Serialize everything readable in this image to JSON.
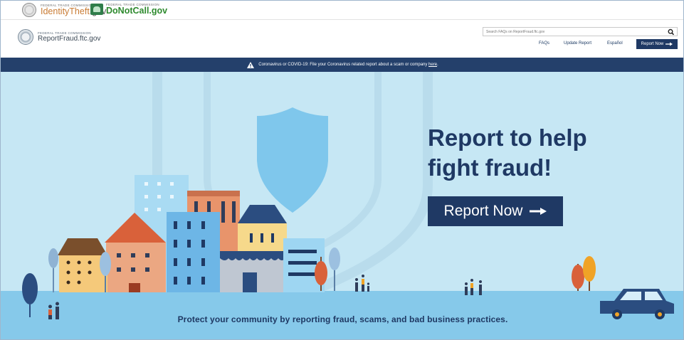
{
  "util_bar": {
    "identitytheft": {
      "agency": "FEDERAL TRADE COMMISSION",
      "name_main": "IdentityTheft",
      "name_tld": ".gov"
    },
    "donotcall": {
      "agency": "FEDERAL TRADE COMMISSION",
      "name": "DoNotCall.gov"
    }
  },
  "header": {
    "agency": "FEDERAL TRADE COMMISSION",
    "site_name": "ReportFraud.ftc.gov",
    "search": {
      "placeholder": "Search FAQs on ReportFraud.ftc.gov"
    },
    "nav": {
      "faqs": "FAQs",
      "update_report": "Update Report",
      "espanol": "Español"
    },
    "report_button": "Report Now"
  },
  "banner": {
    "text": "Coronavirus or COVID-19: File your Coronavirus related report about a scam or company",
    "link": "here",
    "end": "."
  },
  "hero": {
    "title_line1": "Report to help",
    "title_line2": "fight fraud!",
    "button": "Report Now",
    "subtitle": "Protect your community by reporting fraud, scams, and bad business practices."
  },
  "icons": {
    "seal": "ftc-seal-icon",
    "search": "search-icon",
    "warning": "warning-icon",
    "arrow": "arrow-right-icon"
  },
  "colors": {
    "navy": "#1f3964",
    "banner": "#24406b",
    "hero_bg": "#c6e7f4"
  }
}
